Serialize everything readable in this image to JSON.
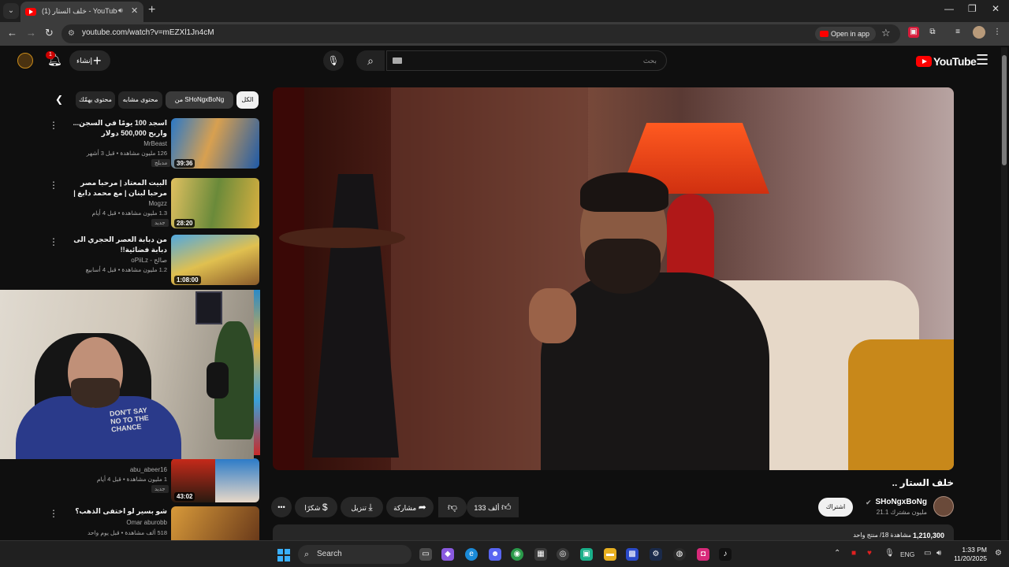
{
  "browser": {
    "tab_title": "(1) خلف الستار - YouTube",
    "url": "youtube.com/watch?v=mEZXl1Jn4cM",
    "open_in_app": "Open in app"
  },
  "masthead": {
    "logo_text": "YouTube",
    "search_placeholder": "بحث",
    "create_label": "إنشاء",
    "notification_count": "1"
  },
  "chips": [
    {
      "label": "الكل",
      "active": false
    },
    {
      "label": "من SHoNgxBoNg",
      "active": true
    },
    {
      "label": "محتوى مشابه",
      "active": false
    },
    {
      "label": "محتوى يهمّك",
      "active": false
    }
  ],
  "recommendations": [
    {
      "title": "اسجد 100 يومًا في السجن... واربح 500,000 دولار",
      "channel": "MrBeast",
      "meta": "126 مليون مشاهدة • قبل 3 أشهر",
      "badge": "مدبلج",
      "duration": "39:36"
    },
    {
      "title": "البيت المعتاد | مرحبا مصر مرحبا لبنان | مع محمد دابغ | Marhba Masr ...",
      "channel": "Mogzz",
      "meta": "1.3 مليون مشاهدة • قبل 4 أيام",
      "badge": "جديد",
      "duration": "28:20"
    },
    {
      "title": "من دبابة العصر الحجري الى دبابة فضائية!!",
      "channel": "oPiiLz - صالح",
      "meta": "1.2 مليون مشاهدة • قبل 4 أسابيع",
      "badge": "",
      "duration": "1:08:00"
    },
    {
      "title": "",
      "channel": "abu_abeer16",
      "meta": "1 مليون مشاهدة • قبل 4 أيام",
      "badge": "جديد",
      "duration": "43:02"
    },
    {
      "title": "شو بسير لو اختفى الذهب؟",
      "channel": "Omar aburobb",
      "meta": "518 ألف مشاهدة • قبل يوم واحد",
      "badge": "",
      "duration": ""
    }
  ],
  "video": {
    "title": "خلف الستار ..",
    "channel_name": "SHoNgxBoNg",
    "subscribers": "21.1 مليون مشترك",
    "subscribe_label": "اشتراك",
    "likes": "133 ألف",
    "share_label": "مشاركة",
    "download_label": "تنزيل",
    "thanks_label": "شكرًا",
    "more_label": "•••",
    "views": "1,210,300",
    "views_label": "مشاهدة 18/ منتج واحد"
  },
  "webcam": {
    "hoodie_text": "DON'T SAY\nNO TO THE\nCHANCE"
  },
  "taskbar": {
    "search_label": "Search",
    "language": "ENG",
    "time": "1:33 PM",
    "date": "11/20/2025"
  },
  "colors": {
    "youtube_red": "#ff0000",
    "background": "#0f0f0f",
    "chip_bg": "#272727"
  },
  "icons": [
    "search-icon",
    "mic-icon",
    "bell-icon",
    "plus-icon",
    "menu-icon",
    "like-icon",
    "dislike-icon",
    "share-icon",
    "download-icon",
    "thanks-icon",
    "star-icon",
    "back-icon",
    "forward-icon",
    "reload-icon"
  ]
}
